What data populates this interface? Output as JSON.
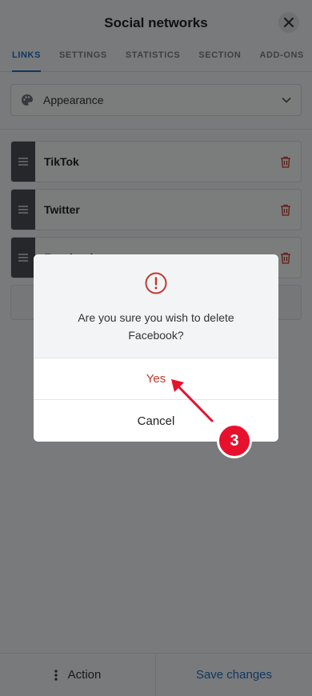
{
  "header": {
    "title": "Social networks"
  },
  "tabs": [
    {
      "label": "LINKS",
      "active": true
    },
    {
      "label": "SETTINGS",
      "active": false
    },
    {
      "label": "STATISTICS",
      "active": false
    },
    {
      "label": "SECTION",
      "active": false
    },
    {
      "label": "ADD-ONS",
      "active": false
    }
  ],
  "appearance": {
    "label": "Appearance"
  },
  "links": [
    {
      "label": "TikTok"
    },
    {
      "label": "Twitter"
    },
    {
      "label": "Facebook"
    }
  ],
  "footer": {
    "action_label": "Action",
    "save_label": "Save changes"
  },
  "dialog": {
    "message": "Are you sure you wish to delete Facebook?",
    "yes_label": "Yes",
    "cancel_label": "Cancel"
  },
  "annotation": {
    "step": "3",
    "color": "#e8112d"
  },
  "colors": {
    "accent": "#1f6fc0",
    "danger": "#c0392b",
    "handle": "#4a4f56"
  }
}
